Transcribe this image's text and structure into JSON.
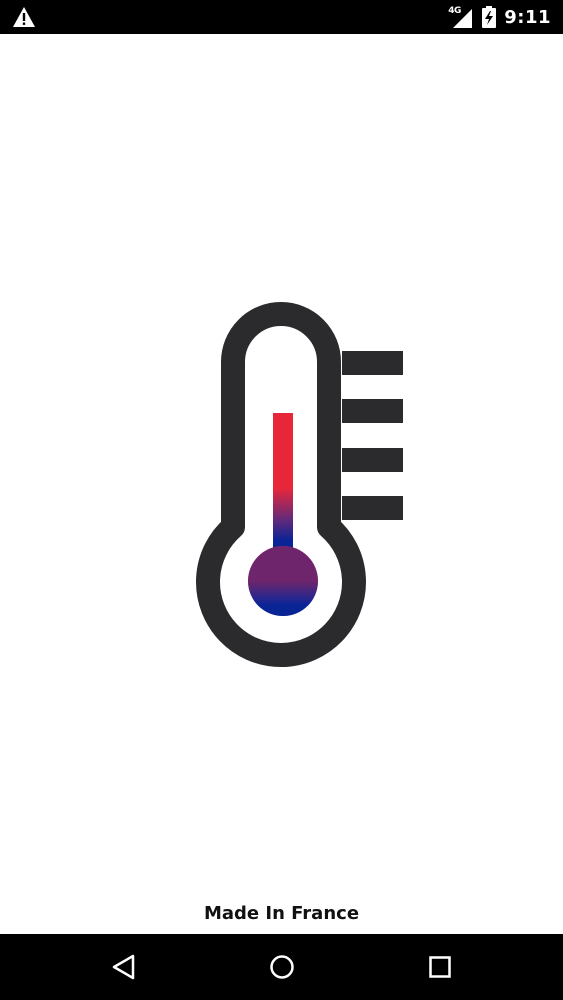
{
  "status_bar": {
    "network_type": "4G",
    "time": "9:11",
    "icons": [
      "warning-icon",
      "signal-icon",
      "battery-charging-icon"
    ]
  },
  "splash": {
    "logo_icon": "thermometer-icon",
    "footer": "Made In France"
  },
  "navigation": {
    "back_icon": "back-triangle-icon",
    "home_icon": "home-circle-icon",
    "recents_icon": "recents-square-icon"
  },
  "colors": {
    "bar_background": "#000000",
    "screen_background": "#ffffff",
    "thermometer_outline": "#2b2a2d",
    "mercury_red": "#e8263a",
    "mercury_blue": "#0a2496"
  }
}
